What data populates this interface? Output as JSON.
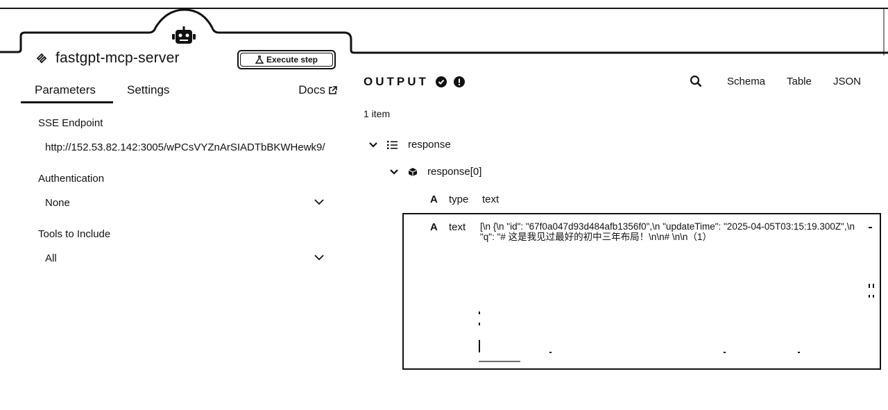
{
  "node": {
    "title": "fastgpt-mcp-server",
    "execute_label": "Execute step",
    "tabs": [
      "Parameters",
      "Settings"
    ],
    "docs_label": "Docs",
    "icons": {
      "tool": "tool-icon",
      "robot": "robot-icon",
      "external": "external-link-icon",
      "flask": "flask-icon"
    }
  },
  "params": {
    "sse_label": "SSE Endpoint",
    "sse_value": "http://152.53.82.142:3005/wPCsVYZnArSIADTbBKWHewk9/",
    "auth_label": "Authentication",
    "auth_value": "None",
    "tools_label": "Tools to Include",
    "tools_value": "All"
  },
  "output": {
    "title": "OUTPUT",
    "views": [
      "Schema",
      "Table",
      "JSON"
    ],
    "item_count": "1 item",
    "tree": {
      "root_key": "response",
      "child_key": "response[0]",
      "type_key": "type",
      "type_value": "text",
      "text_key": "text",
      "text_value": "[\\n {\\n \"id\": \"67f0a047d93d484afb1356f0\",\\n \"updateTime\": \"2025-04-05T03:15:19.300Z\",\\n \"q\": \"# 这是我见过最好的初中三年布局！\\n\\n# \\n\\n（1）"
    },
    "type_glyph": "A"
  },
  "colors": {
    "ink": "#111111",
    "background": "#ffffff"
  }
}
